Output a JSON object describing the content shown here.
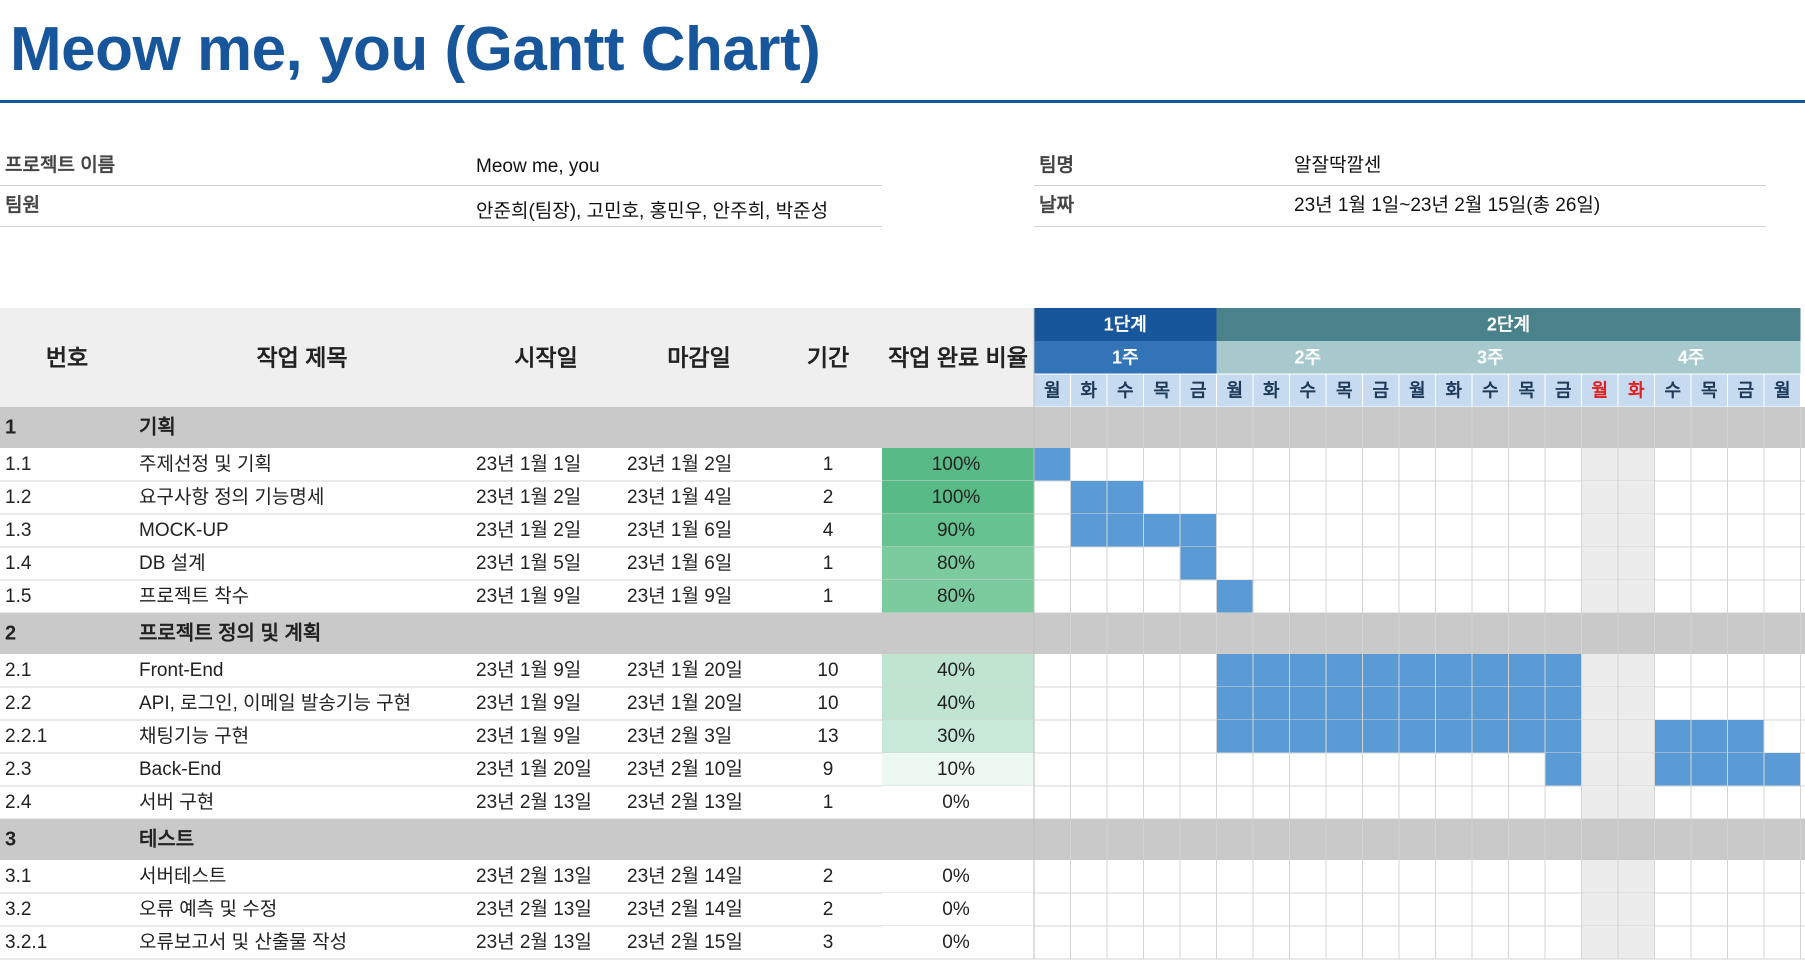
{
  "title": "Meow me, you (Gantt Chart)",
  "info": {
    "project_label": "프로젝트 이름",
    "project_value": "Meow me, you",
    "members_label": "팀원",
    "members_value": "안준희(팀장), 고민호, 홍민우, 안주희, 박준성",
    "team_label": "팀명",
    "team_value": "알잘딱깔센",
    "date_label": "날짜",
    "date_value": "23년 1월 1일~23년 2월 15일(총 26일)"
  },
  "headers": {
    "num": "번호",
    "task": "작업 제목",
    "start": "시작일",
    "end": "마감일",
    "duration": "기간",
    "progress": "작업 완료 비율"
  },
  "phases": [
    {
      "label": "1단계",
      "from": 0,
      "to": 5
    },
    {
      "label": "2단계",
      "from": 5,
      "to": 21
    }
  ],
  "weeks": [
    {
      "label": "1주",
      "from": 0,
      "to": 5
    },
    {
      "label": "2주",
      "from": 5,
      "to": 10
    },
    {
      "label": "3주",
      "from": 10,
      "to": 15
    },
    {
      "label": "4주",
      "from": 15,
      "to": 21
    }
  ],
  "days": [
    "월",
    "화",
    "수",
    "목",
    "금",
    "월",
    "화",
    "수",
    "목",
    "금",
    "월",
    "화",
    "수",
    "목",
    "금",
    "월",
    "화",
    "수",
    "목",
    "금",
    "월"
  ],
  "holidays": [
    15,
    16
  ],
  "rows": [
    {
      "type": "section",
      "num": "1",
      "task": "기획"
    },
    {
      "type": "task",
      "num": "1.1",
      "task": "주제선정 및 기획",
      "start": "23년 1월 1일",
      "end": "23년 1월 2일",
      "duration": "1",
      "progress": "100%",
      "pct": 100,
      "bars": [
        0
      ]
    },
    {
      "type": "task",
      "num": "1.2",
      "task": "요구사항 정의 기능명세",
      "start": "23년 1월 2일",
      "end": "23년 1월 4일",
      "duration": "2",
      "progress": "100%",
      "pct": 100,
      "bars": [
        1,
        2
      ]
    },
    {
      "type": "task",
      "num": "1.3",
      "task": "MOCK-UP",
      "start": "23년 1월 2일",
      "end": "23년 1월 6일",
      "duration": "4",
      "progress": "90%",
      "pct": 90,
      "bars": [
        1,
        2,
        3,
        4
      ]
    },
    {
      "type": "task",
      "num": "1.4",
      "task": "DB 설계",
      "start": "23년 1월 5일",
      "end": "23년 1월 6일",
      "duration": "1",
      "progress": "80%",
      "pct": 80,
      "bars": [
        4
      ]
    },
    {
      "type": "task",
      "num": "1.5",
      "task": "프로젝트 착수",
      "start": "23년 1월 9일",
      "end": "23년 1월 9일",
      "duration": "1",
      "progress": "80%",
      "pct": 80,
      "bars": [
        5
      ]
    },
    {
      "type": "section",
      "num": "2",
      "task": "프로젝트 정의 및 계획"
    },
    {
      "type": "task",
      "num": "2.1",
      "task": "Front-End",
      "start": "23년 1월 9일",
      "end": "23년 1월 20일",
      "duration": "10",
      "progress": "40%",
      "pct": 40,
      "bars": [
        5,
        6,
        7,
        8,
        9,
        10,
        11,
        12,
        13,
        14
      ]
    },
    {
      "type": "task",
      "num": "2.2",
      "task": "API, 로그인, 이메일 발송기능 구현",
      "start": "23년 1월 9일",
      "end": "23년 1월 20일",
      "duration": "10",
      "progress": "40%",
      "pct": 40,
      "bars": [
        5,
        6,
        7,
        8,
        9,
        10,
        11,
        12,
        13,
        14
      ]
    },
    {
      "type": "task",
      "num": "2.2.1",
      "task": "채팅기능 구현",
      "start": "23년 1월 9일",
      "end": "23년 2월 3일",
      "duration": "13",
      "progress": "30%",
      "pct": 30,
      "bars": [
        5,
        6,
        7,
        8,
        9,
        10,
        11,
        12,
        13,
        14,
        17,
        18,
        19
      ]
    },
    {
      "type": "task",
      "num": "2.3",
      "task": "Back-End",
      "start": "23년 1월 20일",
      "end": "23년 2월 10일",
      "duration": "9",
      "progress": "10%",
      "pct": 10,
      "bars": [
        14,
        17,
        18,
        19,
        20
      ]
    },
    {
      "type": "task",
      "num": "2.4",
      "task": "서버 구현",
      "start": "23년 2월 13일",
      "end": "23년 2월 13일",
      "duration": "1",
      "progress": "0%",
      "pct": 0,
      "bars": []
    },
    {
      "type": "section",
      "num": "3",
      "task": "테스트"
    },
    {
      "type": "task",
      "num": "3.1",
      "task": "서버테스트",
      "start": "23년 2월 13일",
      "end": "23년 2월 14일",
      "duration": "2",
      "progress": "0%",
      "pct": 0,
      "bars": []
    },
    {
      "type": "task",
      "num": "3.2",
      "task": "오류 예측 및 수정",
      "start": "23년 2월 13일",
      "end": "23년 2월 14일",
      "duration": "2",
      "progress": "0%",
      "pct": 0,
      "bars": []
    },
    {
      "type": "task",
      "num": "3.2.1",
      "task": "오류보고서 및 산출물 작성",
      "start": "23년 2월 13일",
      "end": "23년 2월 15일",
      "duration": "3",
      "progress": "0%",
      "pct": 0,
      "bars": []
    }
  ],
  "colors": {
    "title": "#17569b",
    "phase1": "#17569b",
    "phase2": "#4a828c",
    "week1": "#3373b8",
    "week_other": "#a7c8cd",
    "day_bg": "#c6dbef",
    "bar": "#5b9bd5",
    "holiday_text": "#e02020",
    "section_bg": "#c9c9c9",
    "header_bg": "#efefef"
  }
}
